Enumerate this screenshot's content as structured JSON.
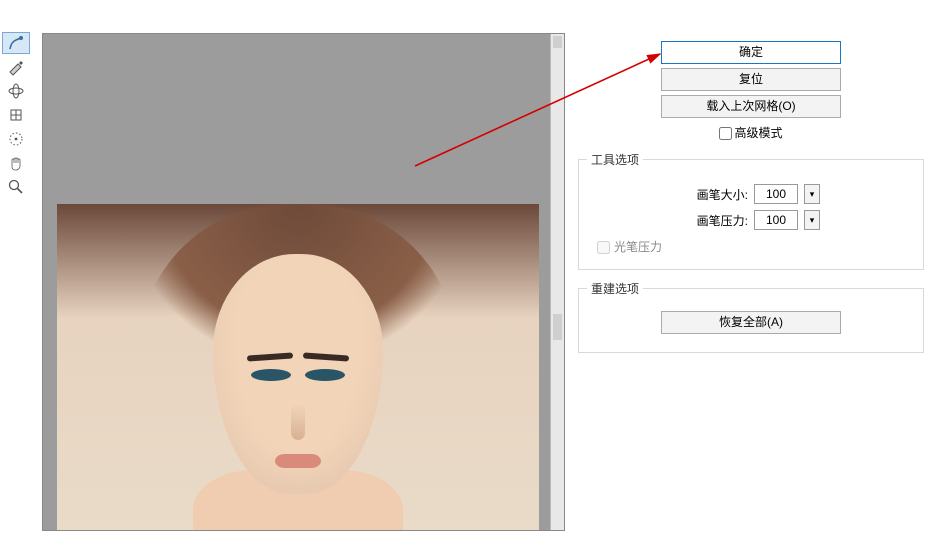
{
  "buttons": {
    "ok": "确定",
    "reset": "复位",
    "loadLastMesh": "载入上次网格(O)",
    "restoreAll": "恢复全部(A)"
  },
  "checks": {
    "advancedMode": "高级模式",
    "stylusPressure": "光笔压力"
  },
  "groups": {
    "toolOptions": "工具选项",
    "rebuildOptions": "重建选项"
  },
  "options": {
    "brushSizeLabel": "画笔大小:",
    "brushPressureLabel": "画笔压力:",
    "brushSize": "100",
    "brushPressure": "100"
  },
  "tools": {
    "warp": "forward-warp-tool",
    "reconstruct": "reconstruct-tool",
    "pucker": "pucker-tool",
    "bloat": "bloat-tool",
    "pushLeft": "push-left-tool",
    "hand": "hand-tool",
    "zoom": "zoom-tool"
  }
}
